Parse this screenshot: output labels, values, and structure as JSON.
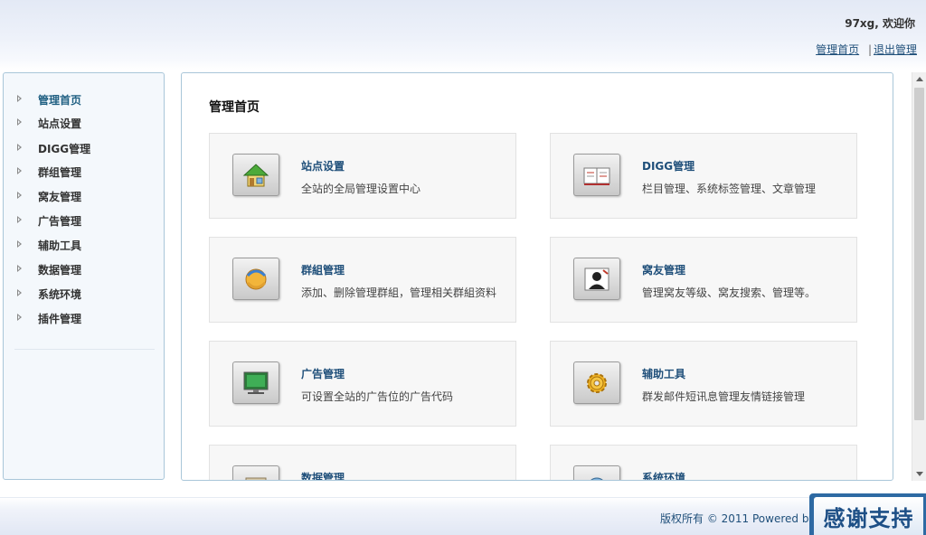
{
  "header": {
    "welcome": "97xg, 欢迎你",
    "link_home": "管理首页",
    "separator": "|",
    "link_logout": "退出管理"
  },
  "sidebar": {
    "items": [
      {
        "label": "管理首页",
        "active": true
      },
      {
        "label": "站点设置"
      },
      {
        "label": "DIGG管理"
      },
      {
        "label": "群组管理"
      },
      {
        "label": "窝友管理"
      },
      {
        "label": "广告管理"
      },
      {
        "label": "辅助工具"
      },
      {
        "label": "数据管理"
      },
      {
        "label": "系统环境"
      },
      {
        "label": "插件管理"
      }
    ]
  },
  "main": {
    "title": "管理首页",
    "cards": [
      {
        "title": "站点设置",
        "desc": "全站的全局管理设置中心",
        "icon": "home-icon"
      },
      {
        "title": "DIGG管理",
        "desc": "栏目管理、系统标签管理、文章管理",
        "icon": "book-icon"
      },
      {
        "title": "群組管理",
        "desc": "添加、删除管理群組，管理相关群組资料",
        "icon": "group-icon"
      },
      {
        "title": "窝友管理",
        "desc": "管理窝友等级、窝友搜索、管理等。",
        "icon": "user-icon"
      },
      {
        "title": "广告管理",
        "desc": "可设置全站的广告位的广告代码",
        "icon": "monitor-icon"
      },
      {
        "title": "辅助工具",
        "desc": "群发邮件短讯息管理友情链接管理",
        "icon": "gear-icon"
      },
      {
        "title": "数据管理",
        "desc": "",
        "icon": "database-icon"
      },
      {
        "title": "系统环境",
        "desc": "",
        "icon": "globe-icon"
      }
    ]
  },
  "footer": {
    "copyright": "版权所有 © 2011 Powered by",
    "badge": "感谢支持"
  },
  "colors": {
    "link": "#1f4f7a",
    "border": "#a9c6d9",
    "badge": "#2e6aa3"
  }
}
